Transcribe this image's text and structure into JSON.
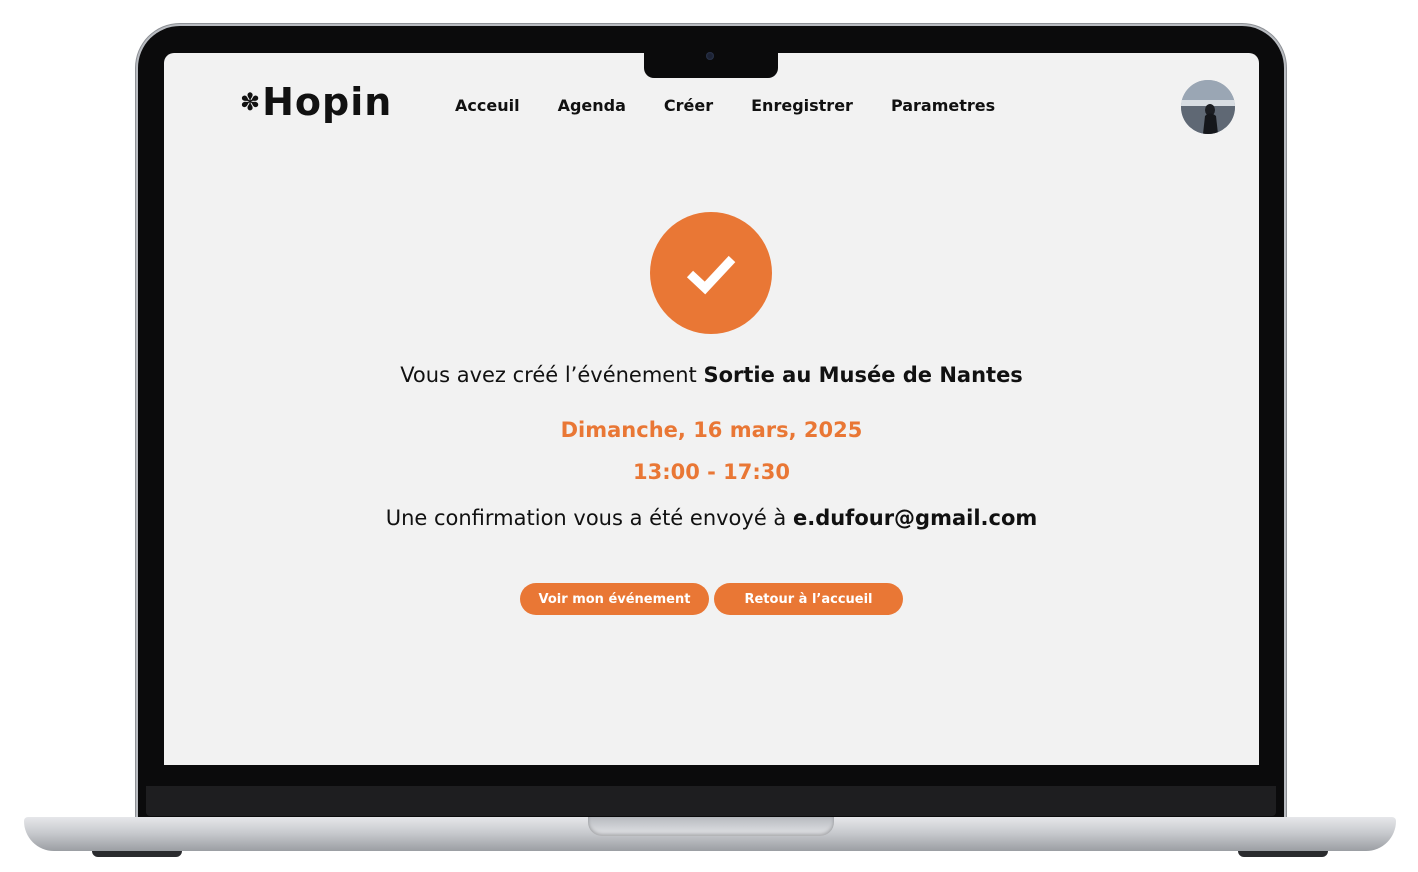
{
  "header": {
    "logo_text": "Hopin",
    "logo_icon": "flower-icon",
    "nav": [
      {
        "label": "Acceuil"
      },
      {
        "label": "Agenda"
      },
      {
        "label": "Créer"
      },
      {
        "label": "Enregistrer"
      },
      {
        "label": "Parametres"
      }
    ]
  },
  "confirmation": {
    "icon": "check-icon",
    "intro_text": "Vous avez créé l’événement",
    "event_name": "Sortie au Musée de Nantes",
    "date": "Dimanche, 16 mars, 2025",
    "time": "13:00 - 17:30",
    "sent_text": "Une confirmation vous a été envoyé à",
    "email": "e.dufour@gmail.com"
  },
  "actions": {
    "view_event_label": "Voir mon événement",
    "back_home_label": "Retour à l’accueil"
  },
  "colors": {
    "accent": "#e97735",
    "background": "#f2f2f2",
    "text": "#111111"
  }
}
